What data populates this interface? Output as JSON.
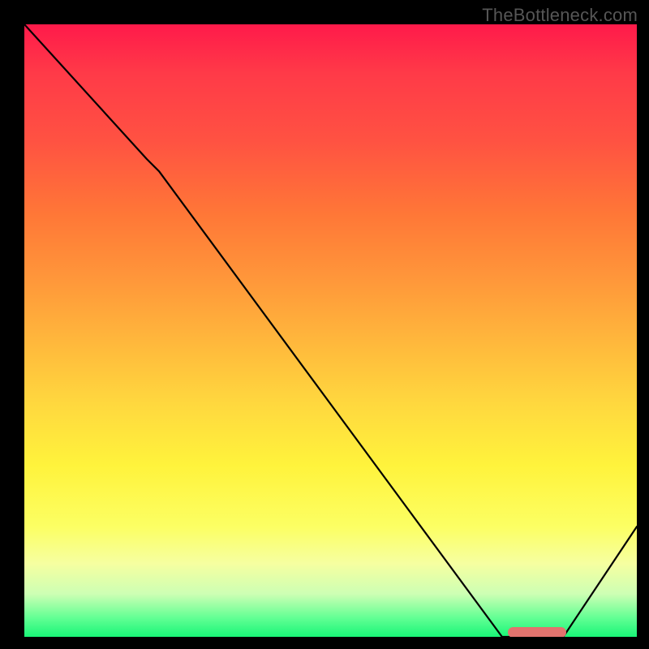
{
  "watermark": "TheBottleneck.com",
  "chart_data": {
    "type": "line",
    "title": "",
    "xlabel": "",
    "ylabel": "",
    "xlim": [
      0,
      100
    ],
    "ylim": [
      0,
      100
    ],
    "grid": false,
    "legend": false,
    "background_gradient": {
      "direction": "vertical",
      "stops": [
        {
          "pos": 0,
          "color": "#ff1a4a"
        },
        {
          "pos": 50,
          "color": "#ffc63d"
        },
        {
          "pos": 80,
          "color": "#fcff63"
        },
        {
          "pos": 100,
          "color": "#19f577"
        }
      ]
    },
    "series": [
      {
        "name": "bottleneck-curve",
        "color": "#000000",
        "x": [
          0,
          20,
          22,
          78,
          82,
          88,
          100
        ],
        "values": [
          100,
          78,
          76,
          0,
          0,
          0,
          18
        ]
      }
    ],
    "annotations": [
      {
        "name": "optimal-marker",
        "type": "bar-segment",
        "color": "#e2736e",
        "x_start": 79,
        "x_end": 88.5,
        "y": 0.8
      }
    ]
  }
}
